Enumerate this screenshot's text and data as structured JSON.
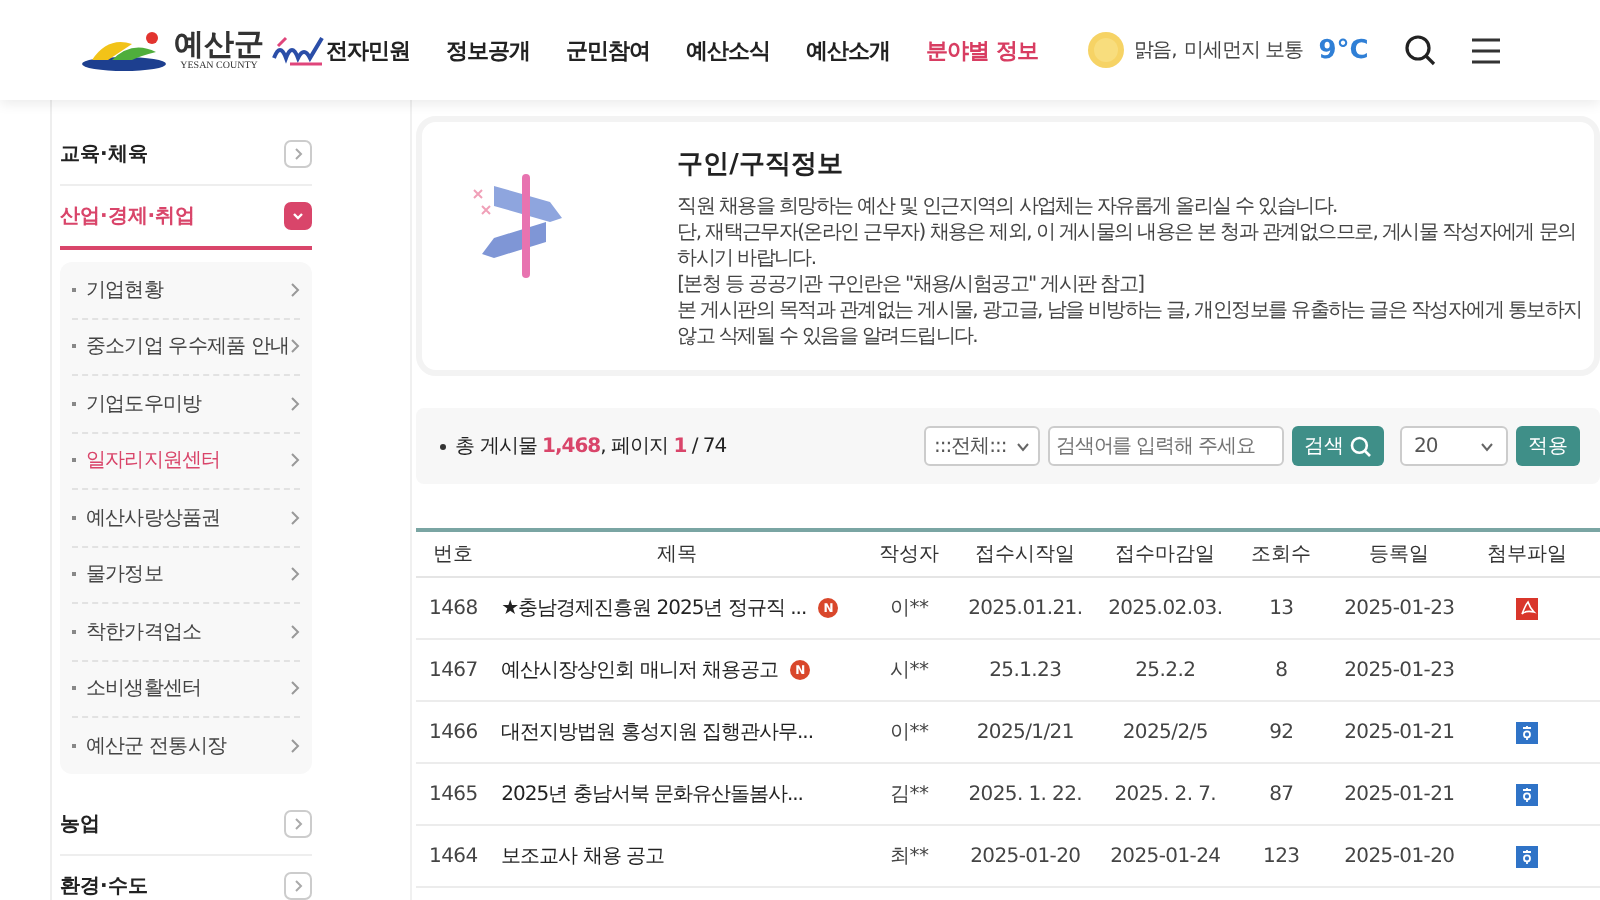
{
  "header": {
    "logo": {
      "name": "예산군",
      "sub": "YESAN COUNTY"
    },
    "nav": [
      {
        "label": "전자민원",
        "selected": false
      },
      {
        "label": "정보공개",
        "selected": false
      },
      {
        "label": "군민참여",
        "selected": false
      },
      {
        "label": "예산소식",
        "selected": false
      },
      {
        "label": "예산소개",
        "selected": false
      },
      {
        "label": "분야별 정보",
        "selected": true
      }
    ],
    "weather": {
      "condition": "맑음,",
      "dust": "미세먼지 보통",
      "temperature": "9°C"
    }
  },
  "sidebar": {
    "items": [
      {
        "label": "교육·체육",
        "expanded": false,
        "selected": false
      },
      {
        "label": "산업·경제·취업",
        "expanded": true,
        "selected": true,
        "children": [
          {
            "label": "기업현황",
            "selected": false
          },
          {
            "label": "중소기업 우수제품 안내",
            "selected": false
          },
          {
            "label": "기업도우미방",
            "selected": false
          },
          {
            "label": "일자리지원센터",
            "selected": true
          },
          {
            "label": "예산사랑상품권",
            "selected": false
          },
          {
            "label": "물가정보",
            "selected": false
          },
          {
            "label": "착한가격업소",
            "selected": false
          },
          {
            "label": "소비생활센터",
            "selected": false
          },
          {
            "label": "예산군 전통시장",
            "selected": false
          }
        ]
      },
      {
        "label": "농업",
        "expanded": false,
        "selected": false
      },
      {
        "label": "환경·수도",
        "expanded": false,
        "selected": false
      }
    ]
  },
  "intro": {
    "title": "구인/구직정보",
    "lines": [
      "직원 채용을 희망하는 예산 및 인근지역의 사업체는 자유롭게 올리실 수 있습니다.",
      "단, 재택근무자(온라인 근무자) 채용은 제외, 이 게시물의 내용은 본 청과 관계없으므로, 게시물 작성자에게 문의하시기 바랍니다.",
      "[본청 등 공공기관 구인란은 \"채용/시험공고\" 게시판 참고]",
      "본 게시판의 목적과 관계없는 게시물, 광고글, 남을 비방하는 글, 개인정보를 유출하는 글은 작성자에게 통보하지 않고 삭제될 수 있음을 알려드립니다."
    ]
  },
  "filter": {
    "total_label": "총 게시물",
    "total": "1,468",
    "page_label": ", 페이지",
    "page": "1",
    "page_total": "/ 74",
    "category": ":::전체:::",
    "search": {
      "placeholder": "검색어를 입력해 주세요"
    },
    "search_button": "검색",
    "page_size": "20",
    "apply_button": "적용"
  },
  "table": {
    "columns": [
      "번호",
      "제목",
      "작성자",
      "접수시작일",
      "접수마감일",
      "조회수",
      "등록일",
      "첨부파일"
    ],
    "rows": [
      {
        "no": "1468",
        "title": "★충남경제진흥원 2025년 정규직 ...",
        "new": "N",
        "author": "이**",
        "start": "2025.01.21.",
        "end": "2025.02.03.",
        "views": "13",
        "date": "2025-01-23",
        "attachment": {
          "kind": "pdf"
        }
      },
      {
        "no": "1467",
        "title": "예산시장상인회 매니저 채용공고",
        "new": "N",
        "author": "시**",
        "start": "25.1.23",
        "end": "25.2.2",
        "views": "8",
        "date": "2025-01-23"
      },
      {
        "no": "1466",
        "title": "대전지방법원 홍성지원 집행관사무...",
        "author": "이**",
        "start": "2025/1/21",
        "end": "2025/2/5",
        "views": "92",
        "date": "2025-01-21",
        "attachment": {
          "kind": "hwp"
        }
      },
      {
        "no": "1465",
        "title": "2025년 충남서북 문화유산돌봄사...",
        "author": "김**",
        "start": "2025. 1. 22.",
        "end": "2025. 2. 7.",
        "views": "87",
        "date": "2025-01-21",
        "attachment": {
          "kind": "hwp"
        }
      },
      {
        "no": "1464",
        "title": "보조교사 채용 공고",
        "author": "최**",
        "start": "2025-01-20",
        "end": "2025-01-24",
        "views": "123",
        "date": "2025-01-20",
        "attachment": {
          "kind": "hwp"
        }
      }
    ]
  }
}
